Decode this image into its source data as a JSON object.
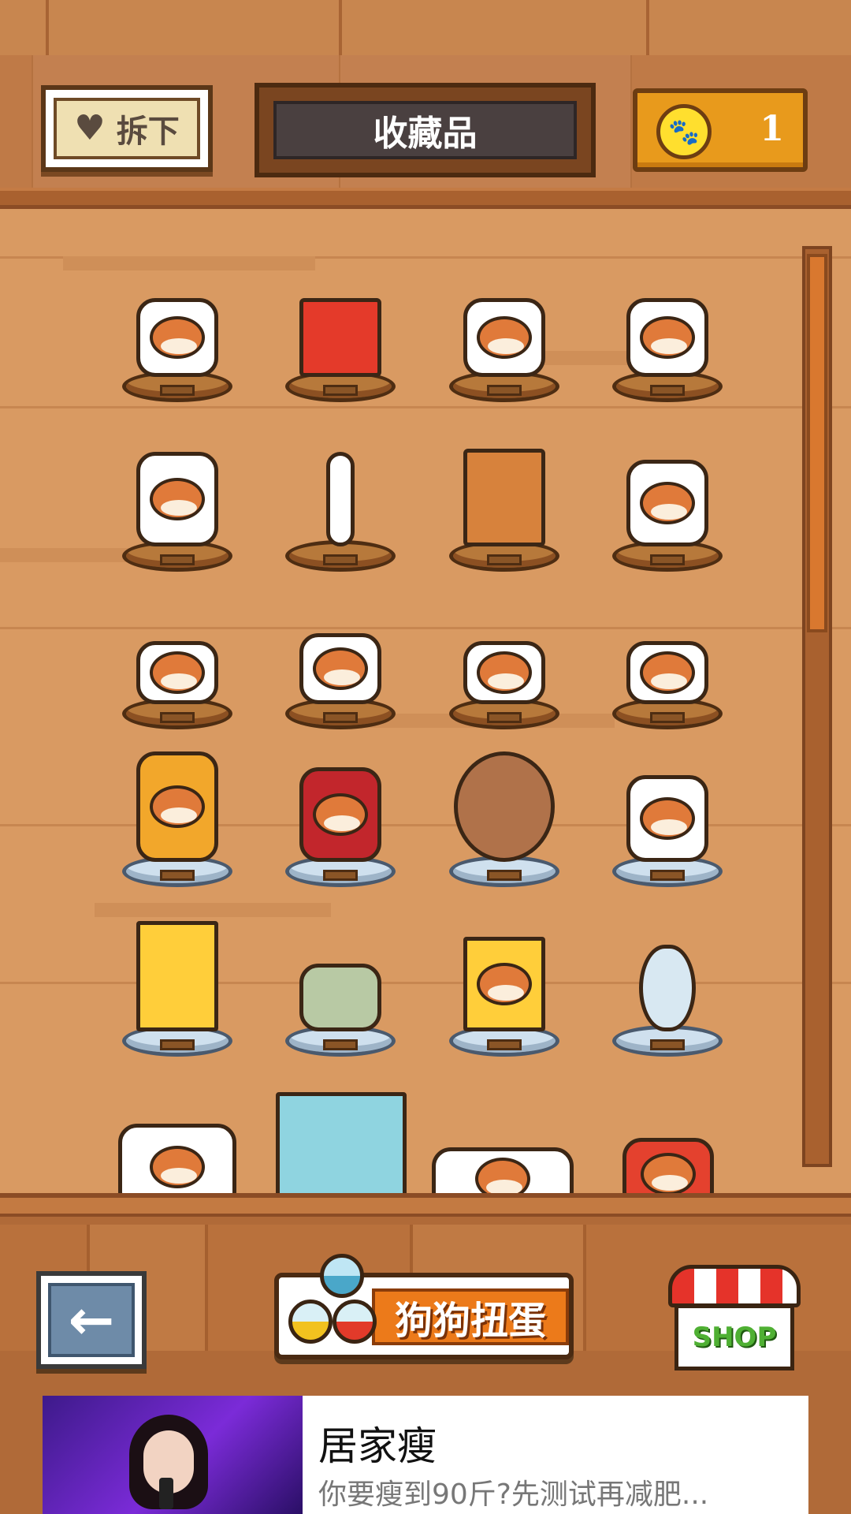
{
  "header": {
    "unequip_label": "拆下",
    "title": "收藏品",
    "coin_count": "1"
  },
  "shelf": {
    "rows": [
      [
        "shiba-figure",
        "shiba-painting",
        "shiba-figure",
        "shiba-with-bowl"
      ],
      [
        "shiba-with-cactus",
        "shiba-lamp",
        "wardrobe",
        "plant-table"
      ],
      [
        "sleeping-shiba",
        "shiba-with-hat",
        "shiba-with-flowers",
        "shiba-with-box"
      ],
      [
        "shiba-armchair",
        "shiba-red-chair",
        "round-window",
        "shiba-sofa"
      ],
      [
        "tv-cabinet",
        "green-cat",
        "computer",
        "shiba-mirror"
      ],
      [
        "shiba-shelf",
        "television",
        "shiba-flowers",
        "shiba-bed"
      ]
    ],
    "scroll_fraction": 0.41
  },
  "bottom": {
    "back_icon": "←",
    "gacha_label": "狗狗扭蛋",
    "shop_label": "SHOP"
  },
  "ad": {
    "title": "居家瘦",
    "description": "你要瘦到90斤?先测试再减肥..."
  }
}
